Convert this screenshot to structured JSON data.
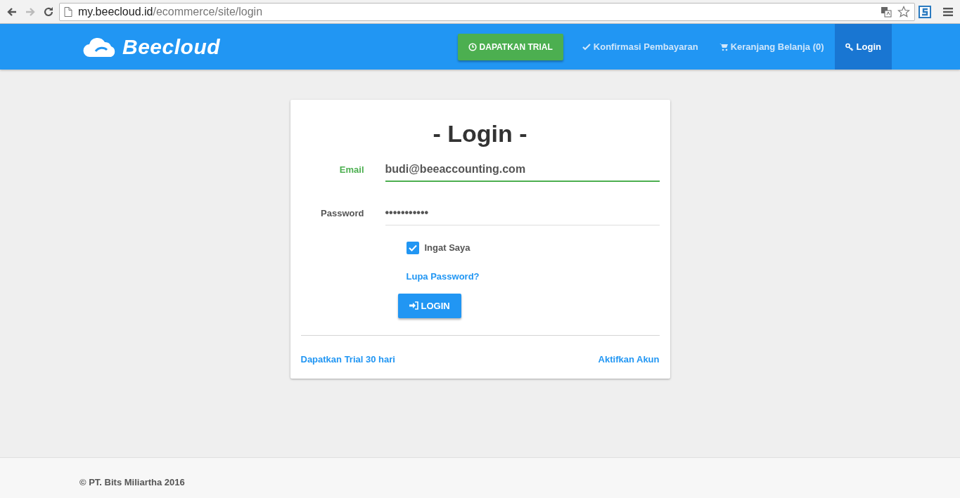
{
  "browser": {
    "url_host": "my.beecloud.id",
    "url_path": "/ecommerce/site/login",
    "forward_disabled": true
  },
  "navbar": {
    "brand": "Beecloud",
    "items": [
      {
        "kind": "button",
        "label": "DAPATKAN TRIAL",
        "selected": false
      },
      {
        "kind": "link",
        "label": "Konfirmasi Pembayaran",
        "selected": false
      },
      {
        "kind": "link",
        "label": "Keranjang Belanja (0)",
        "selected": false
      },
      {
        "kind": "link",
        "label": "Login",
        "selected": true
      }
    ]
  },
  "login": {
    "title": "- Login -",
    "fields": [
      {
        "label": "Email",
        "value": "budi@beeaccounting.com",
        "focused": true
      },
      {
        "label": "Password",
        "value": "•••••••••••",
        "focused": false
      }
    ],
    "remember": {
      "label": "Ingat Saya",
      "checked": true
    },
    "forgot_link": "Lupa Password?",
    "submit": "LOGIN",
    "footer_links": [
      "Dapatkan Trial 30 hari",
      "Aktifkan Akun"
    ]
  },
  "footer": {
    "text": "© PT. Bits Miliartha 2016"
  }
}
